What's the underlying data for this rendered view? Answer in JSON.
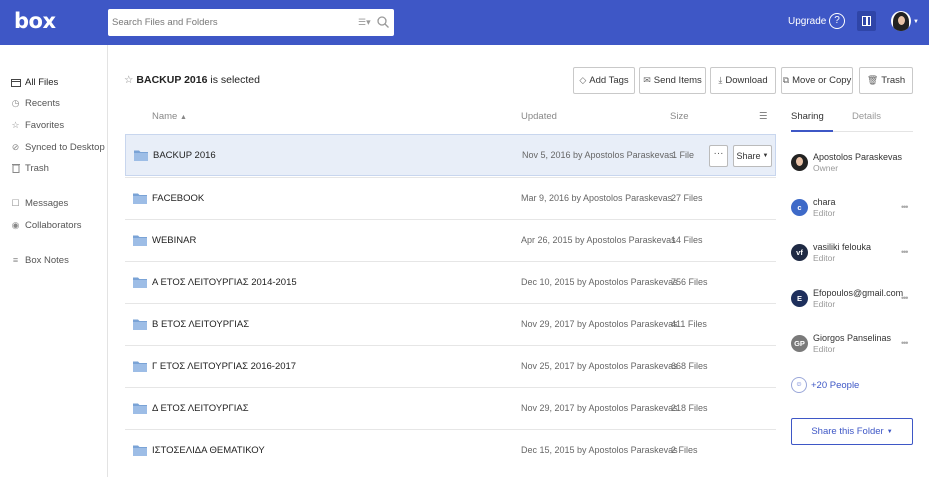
{
  "header": {
    "logo": "box",
    "search_placeholder": "Search Files and Folders",
    "upgrade_label": "Upgrade",
    "help_glyph": "?",
    "colors": {
      "brand": "#3e57c6"
    }
  },
  "sidebar": {
    "items": [
      {
        "label": "All Files",
        "icon": "folder-icon"
      },
      {
        "label": "Recents",
        "icon": "clock-icon"
      },
      {
        "label": "Favorites",
        "icon": "star-icon"
      },
      {
        "label": "Synced to Desktop",
        "icon": "sync-icon"
      },
      {
        "label": "Trash",
        "icon": "trash-icon"
      },
      {
        "label": "Messages",
        "icon": "message-icon"
      },
      {
        "label": "Collaborators",
        "icon": "collaborators-icon"
      },
      {
        "label": "Box Notes",
        "icon": "notes-icon"
      }
    ]
  },
  "main": {
    "selected_name": "BACKUP 2016",
    "selected_suffix": " is selected",
    "toolbar": {
      "add_tags": "Add Tags",
      "send_items": "Send Items",
      "download": "Download",
      "move_or_copy": "Move or Copy",
      "trash": "Trash"
    },
    "columns": {
      "name": "Name",
      "updated": "Updated",
      "size": "Size"
    },
    "rows": [
      {
        "name": "BACKUP 2016",
        "updated": "Nov 5, 2016 by Apostolos Paraskevas",
        "size": "1 File"
      },
      {
        "name": "FACEBOOK",
        "updated": "Mar 9, 2016 by Apostolos Paraskevas",
        "size": "27 Files"
      },
      {
        "name": "WEBINAR",
        "updated": "Apr 26, 2015 by Apostolos Paraskevas",
        "size": "14 Files"
      },
      {
        "name": "Α ΕΤΟΣ ΛΕΙΤΟΥΡΓΙΑΣ 2014-2015",
        "updated": "Dec 10, 2015 by Apostolos Paraskevas",
        "size": "756 Files"
      },
      {
        "name": "Β ΕΤΟΣ ΛΕΙΤΟΥΡΓΙΑΣ",
        "updated": "Nov 29, 2017 by Apostolos Paraskevas",
        "size": "411 Files"
      },
      {
        "name": "Γ ΕΤΟΣ ΛΕΙΤΟΥΡΓΙΑΣ 2016-2017",
        "updated": "Nov 25, 2017 by Apostolos Paraskevas",
        "size": "668 Files"
      },
      {
        "name": "Δ ΕΤΟΣ ΛΕΙΤΟΥΡΓΙΑΣ",
        "updated": "Nov 29, 2017 by Apostolos Paraskevas",
        "size": "218 Files"
      },
      {
        "name": "ΙΣΤΟΣΕΛΙΔΑ ΘΕΜΑΤΙΚΟΥ",
        "updated": "Dec 15, 2015 by Apostolos Paraskevas",
        "size": "2 Files"
      }
    ],
    "row_more": "···",
    "row_share": "Share"
  },
  "rpanel": {
    "tabs": {
      "sharing": "Sharing",
      "details": "Details"
    },
    "collaborators": [
      {
        "initials": "",
        "name": "Apostolos Paraskevas",
        "role": "Owner",
        "color": "#333333"
      },
      {
        "initials": "c",
        "name": "chara",
        "role": "Editor",
        "color": "#3e6ac8"
      },
      {
        "initials": "vf",
        "name": "vasiliki felouka",
        "role": "Editor",
        "color": "#1f2a44"
      },
      {
        "initials": "E",
        "name": "Efopoulos@gmail.com",
        "role": "Editor",
        "color": "#1e2f5c"
      },
      {
        "initials": "GP",
        "name": "Giorgos Panselinas",
        "role": "Editor",
        "color": "#7a7a7a"
      }
    ],
    "more_dots": "•••",
    "people_label": "+20 People",
    "share_folder_label": "Share this Folder"
  }
}
